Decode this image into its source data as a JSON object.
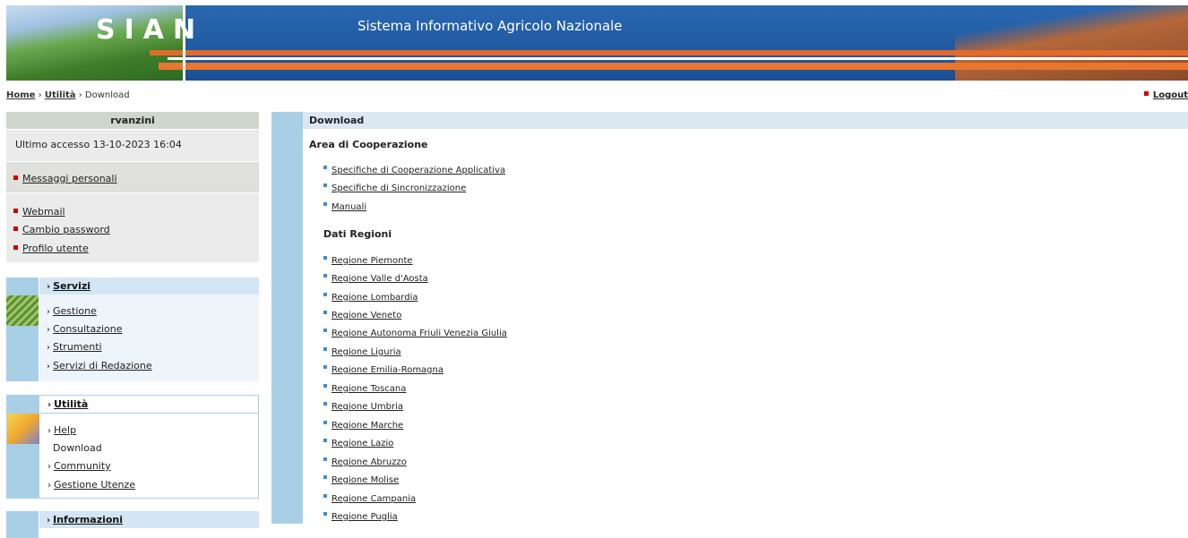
{
  "header": {
    "logo": "SIAN",
    "title": "Sistema Informativo Agricolo Nazionale"
  },
  "breadcrumb": {
    "home": "Home",
    "sep": "›",
    "utilita": "Utilità",
    "current": "Download"
  },
  "logout": "Logout",
  "user": {
    "name": "rvanzini",
    "last_access": "Ultimo accesso 13-10-2023 16:04"
  },
  "personal_links": {
    "messages": "Messaggi personali",
    "webmail": "Webmail",
    "change_password": "Cambio password",
    "profile": "Profilo utente"
  },
  "servizi": {
    "title": "Servizi",
    "items": [
      "Gestione",
      "Consultazione",
      "Strumenti",
      "Servizi di Redazione"
    ]
  },
  "utilita": {
    "title": "Utilità",
    "items": [
      "Help",
      "Download",
      "Community",
      "Gestione Utenze"
    ]
  },
  "informazioni": {
    "title": "Informazioni"
  },
  "main": {
    "header": "Download",
    "section1": {
      "title": "Area di Cooperazione",
      "links": [
        "Specifiche di Cooperazione Applicativa",
        "Specifiche di Sincronizzazione",
        "Manuali"
      ]
    },
    "section2": {
      "title": "Dati Regioni",
      "links": [
        "Regione Piemonte",
        "Regione Valle d'Aosta",
        "Regione Lombardia",
        "Regione Veneto",
        "Regione Autonoma Friuli Venezia Giulia",
        "Regione Liguria",
        "Regione Emilia-Romagna",
        "Regione Toscana",
        "Regione Umbria",
        "Regione Marche",
        "Regione Lazio",
        "Regione Abruzzo",
        "Regione Molise",
        "Regione Campania",
        "Regione Puglia"
      ]
    }
  }
}
